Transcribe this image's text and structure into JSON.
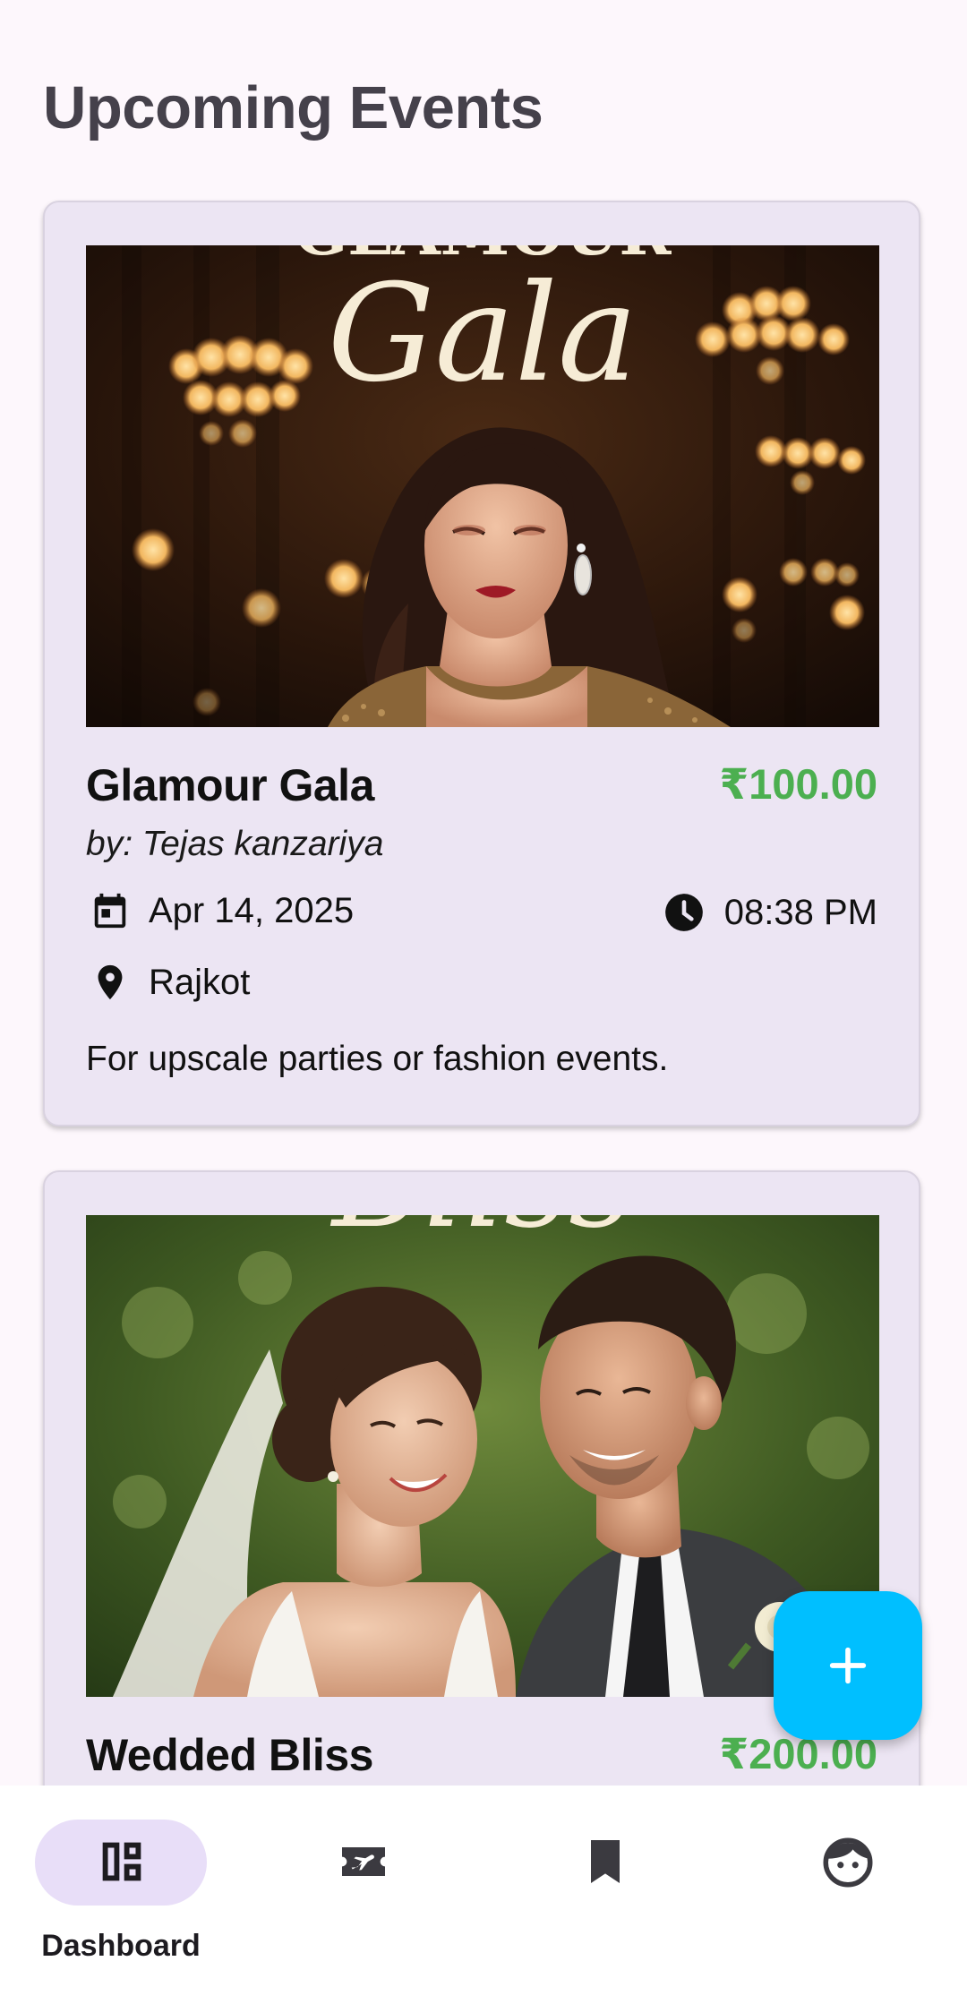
{
  "page": {
    "title": "Upcoming Events"
  },
  "events": [
    {
      "title": "Glamour Gala",
      "price": "₹100.00",
      "organizer": "by: Tejas kanzariya",
      "date": "Apr 14, 2025",
      "time": "08:38 PM",
      "location": "Rajkot",
      "description": "For upscale parties or fashion events.",
      "image_text": "Gala",
      "image_partial_text": "GLAMOUR"
    },
    {
      "title": "Wedded Bliss",
      "price": "₹200.00",
      "image_text": "Bliss"
    }
  ],
  "fab": {
    "icon": "plus-icon"
  },
  "bottom_nav": {
    "items": [
      {
        "label": "Dashboard",
        "icon": "dashboard-icon",
        "selected": true
      },
      {
        "label": "",
        "icon": "ticket-icon",
        "selected": false
      },
      {
        "label": "",
        "icon": "bookmark-icon",
        "selected": false
      },
      {
        "label": "",
        "icon": "profile-face-icon",
        "selected": false
      }
    ]
  },
  "colors": {
    "background": "#FDF7FC",
    "card": "#ECE5F3",
    "price": "#4CAF50",
    "fab": "#00BFFF",
    "nav_indicator": "#E8DEF8",
    "title": "#45414B"
  }
}
